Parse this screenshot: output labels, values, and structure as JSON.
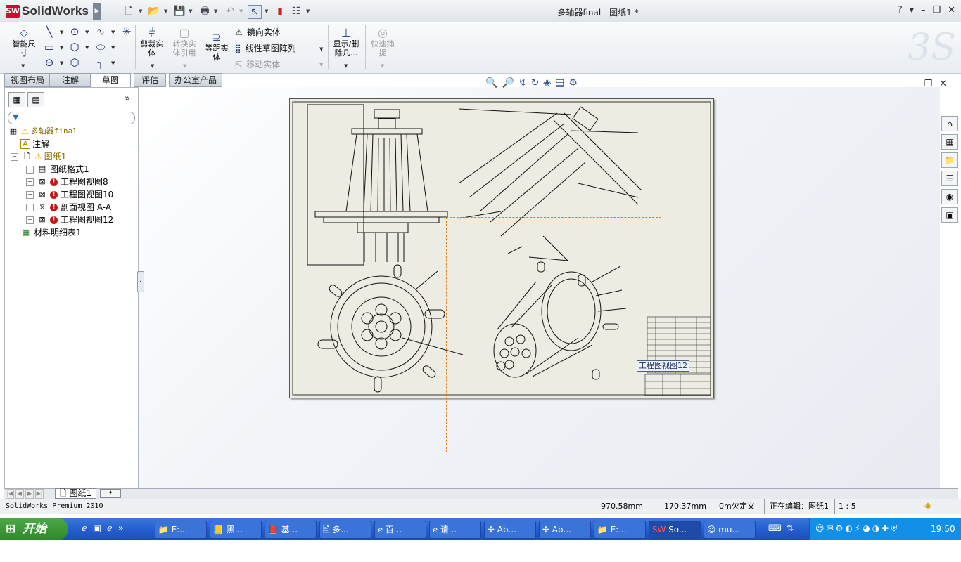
{
  "app": {
    "name": "SolidWorks",
    "logo_mark": "SW"
  },
  "window": {
    "title": "多轴器final - 图纸1 *"
  },
  "quick_access": [
    "new-icon",
    "open-icon",
    "save-icon",
    "print-icon",
    "undo-icon",
    "select-icon",
    "traffic-light-icon",
    "options-icon"
  ],
  "ribbon": {
    "smart_dim": "智能尺寸",
    "trim": "剪裁实体",
    "convert": "转换实体引用",
    "offset": "等距实体",
    "mirror": "镜向实体",
    "linear_pattern": "线性草图阵列",
    "move": "移动实体",
    "display_delete": "显示/删除几...",
    "quick_snap": "快速捕捉"
  },
  "tabs": [
    "视图布局",
    "注解",
    "草图",
    "评估",
    "办公室产品"
  ],
  "active_tab": "草图",
  "tree": {
    "root": "多轴器final",
    "annotations": "注解",
    "sheet": "图纸1",
    "items": [
      {
        "label": "图纸格式1",
        "error": false
      },
      {
        "label": "工程图视图8",
        "error": true
      },
      {
        "label": "工程图视图10",
        "error": true
      },
      {
        "label": "剖面视图 A-A",
        "error": true
      },
      {
        "label": "工程图视图12",
        "error": true
      }
    ],
    "bom": "材料明细表1"
  },
  "drawing": {
    "view_label": "工程图视图12"
  },
  "sheet_tab": "图纸1",
  "status": {
    "product": "SolidWorks Premium 2010",
    "x": "970.58mm",
    "y": "170.37mm",
    "z": "0m",
    "defined": "欠定义",
    "editing": "正在编辑：图纸1",
    "scale": "1 : 5"
  },
  "taskbar": {
    "start": "开始",
    "items": [
      "E:...",
      "黑...",
      "基...",
      "多...",
      "百...",
      "请...",
      "Ab...",
      "Ab...",
      "E:...",
      "So...",
      "mu..."
    ],
    "clock": "19:50"
  }
}
